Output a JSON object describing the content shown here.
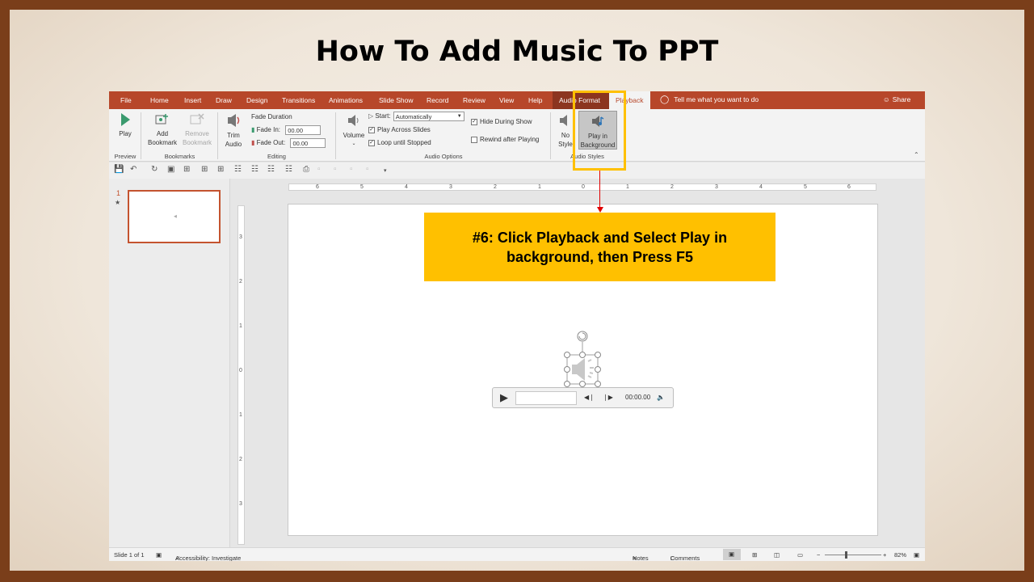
{
  "title": "How To Add Music To PPT",
  "tabs": [
    "File",
    "Home",
    "Insert",
    "Draw",
    "Design",
    "Transitions",
    "Animations",
    "Slide Show",
    "Record",
    "Review",
    "View",
    "Help",
    "Audio Format",
    "Playback"
  ],
  "tell_me": "Tell me what you want to do",
  "share": "Share",
  "ribbon": {
    "play": "Play",
    "preview_group": "Preview",
    "add_bookmark": [
      "Add",
      "Bookmark"
    ],
    "remove_bookmark": [
      "Remove",
      "Bookmark"
    ],
    "bookmarks_group": "Bookmarks",
    "trim": [
      "Trim",
      "Audio"
    ],
    "fade_duration": "Fade Duration",
    "fade_in_label": "Fade In:",
    "fade_in_value": "00.00",
    "fade_out_label": "Fade Out:",
    "fade_out_value": "00.00",
    "editing_group": "Editing",
    "volume": "Volume",
    "start_label": "Start:",
    "start_value": "Automatically",
    "play_across": "Play Across Slides",
    "loop": "Loop until Stopped",
    "hide_during_show": "Hide During Show",
    "rewind": "Rewind after Playing",
    "audio_options_group": "Audio Options",
    "no_style": [
      "No",
      "Style"
    ],
    "play_bg": [
      "Play in",
      "Background"
    ],
    "audio_styles_group": "Audio Styles"
  },
  "slide_number": "1",
  "ruler_h": [
    "6",
    "5",
    "4",
    "3",
    "2",
    "1",
    "0",
    "1",
    "2",
    "3",
    "4",
    "5",
    "6"
  ],
  "ruler_v": [
    "3",
    "2",
    "1",
    "0",
    "1",
    "2",
    "3"
  ],
  "callout": "#6: Click Playback and Select Play in background, then Press F5",
  "player_time": "00:00.00",
  "status": {
    "slide_of": "Slide 1 of 1",
    "accessibility": "Accessibility: Investigate",
    "notes": "Notes",
    "comments": "Comments",
    "zoom": "82%",
    "zoom_minus": "−",
    "zoom_plus": "+"
  },
  "colors": {
    "tab_red": "#b7472a",
    "callout": "#ffc000",
    "arrow": "#e00000"
  }
}
